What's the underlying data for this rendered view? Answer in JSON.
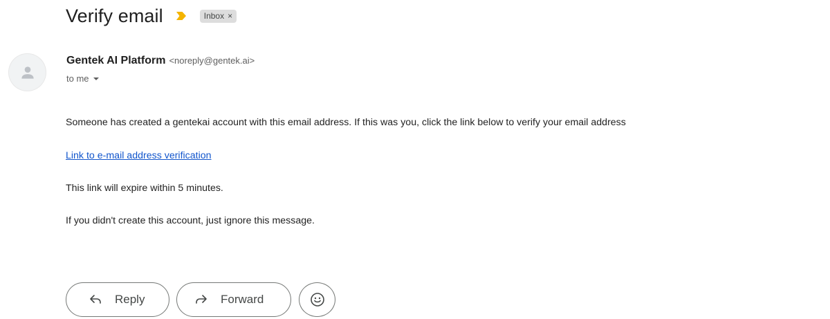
{
  "email": {
    "subject": "Verify email",
    "label": "Inbox",
    "label_close": "×",
    "sender": {
      "name": "Gentek AI Platform",
      "email": "<noreply@gentek.ai>",
      "avatar_icon": "person-icon"
    },
    "recipient": "to me",
    "body": {
      "paragraph_1": "Someone has created a gentekai account with this email address. If this was you, click the link below to verify your email address",
      "link_text": "Link to e-mail address verification",
      "paragraph_2": "This link will expire within 5 minutes.",
      "paragraph_3": "If you didn't create this account, just ignore this message."
    }
  },
  "actions": {
    "reply_label": "Reply",
    "forward_label": "Forward",
    "reply_icon": "reply-arrow-icon",
    "forward_icon": "forward-arrow-icon",
    "emoji_icon": "smiley-icon"
  },
  "colors": {
    "importance_marker": "#f4b400",
    "link": "#1155cc",
    "label_chip_bg": "#dddddd"
  }
}
